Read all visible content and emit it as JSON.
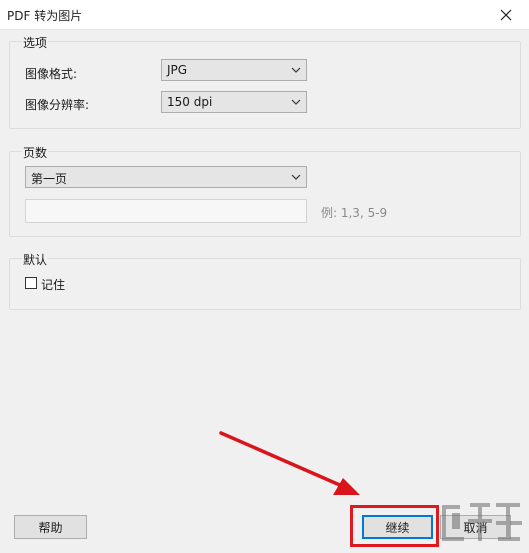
{
  "window": {
    "title": "PDF 转为图片"
  },
  "options": {
    "title": "选项",
    "format_label": "图像格式:",
    "format_value": "JPG",
    "resolution_label": "图像分辨率:",
    "resolution_value": "150 dpi"
  },
  "pages": {
    "title": "页数",
    "range_value": "第一页",
    "custom_value": "",
    "hint": "例: 1,3, 5-9"
  },
  "defaults": {
    "title": "默认",
    "remember_label": "记住",
    "remember_checked": false
  },
  "buttons": {
    "help": "帮助",
    "continue": "继续",
    "cancel": "取消"
  },
  "annotation": {
    "highlight_color": "#e0191f",
    "arrow_color": "#d9141b"
  },
  "icons": {
    "close": "close-icon",
    "dropdown": "chevron-down-icon",
    "watermark": "watermark-logo"
  }
}
